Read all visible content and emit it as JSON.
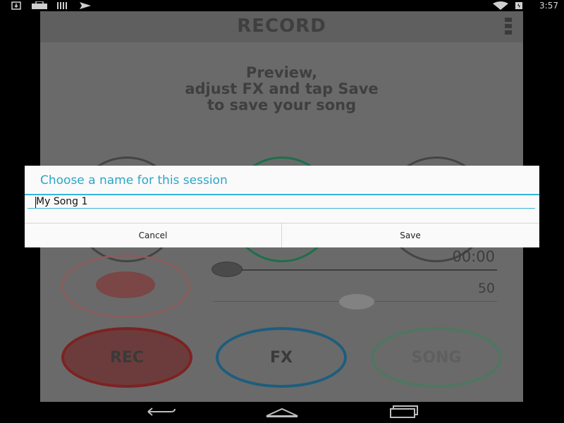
{
  "status_bar": {
    "time": "3:57",
    "left_icons": [
      "download-icon",
      "toolbox-icon",
      "barcode-icon",
      "paper-plane-icon"
    ],
    "right_icons": [
      "wifi-icon",
      "battery-icon"
    ]
  },
  "app": {
    "title": "RECORD",
    "instructions": [
      "Preview,",
      "adjust FX and tap Save",
      "to save your song"
    ],
    "timer": "00:00",
    "volume": "50",
    "volume_level": 0.5,
    "buttons": {
      "rec": "REC",
      "fx": "FX",
      "song": "SONG"
    },
    "colors": {
      "rec": "#7d2222",
      "fx": "#1d5d7d",
      "song": "#4f7661"
    }
  },
  "dialog": {
    "title": "Choose a name for this session",
    "input_value": "My Song 1",
    "cancel_label": "Cancel",
    "save_label": "Save",
    "accent_color": "#2ba6c8"
  },
  "nav_bar": {
    "icons": [
      "back-icon",
      "home-icon",
      "recents-icon"
    ]
  }
}
